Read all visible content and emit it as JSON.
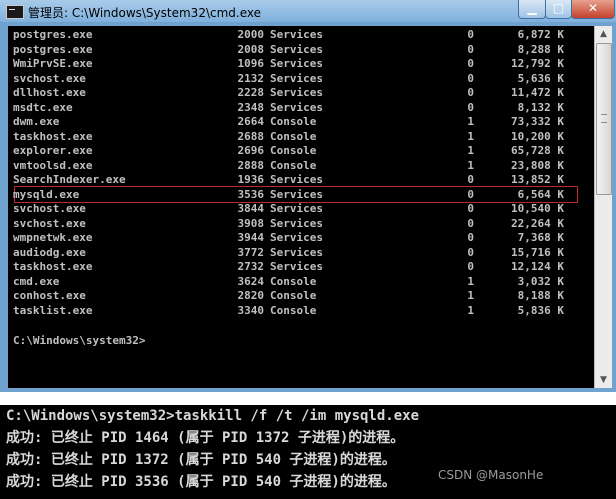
{
  "window": {
    "title": "管理员: C:\\Windows\\System32\\cmd.exe",
    "min_glyph": "▁",
    "max_glyph": "□",
    "close_glyph": "✕"
  },
  "tasklist": [
    {
      "name": "postgres.exe",
      "pid": "2000",
      "session": "Services",
      "num": "0",
      "mem": "6,872 K"
    },
    {
      "name": "postgres.exe",
      "pid": "2008",
      "session": "Services",
      "num": "0",
      "mem": "8,288 K"
    },
    {
      "name": "WmiPrvSE.exe",
      "pid": "1096",
      "session": "Services",
      "num": "0",
      "mem": "12,792 K"
    },
    {
      "name": "svchost.exe",
      "pid": "2132",
      "session": "Services",
      "num": "0",
      "mem": "5,636 K"
    },
    {
      "name": "dllhost.exe",
      "pid": "2228",
      "session": "Services",
      "num": "0",
      "mem": "11,472 K"
    },
    {
      "name": "msdtc.exe",
      "pid": "2348",
      "session": "Services",
      "num": "0",
      "mem": "8,132 K"
    },
    {
      "name": "dwm.exe",
      "pid": "2664",
      "session": "Console",
      "num": "1",
      "mem": "73,332 K"
    },
    {
      "name": "taskhost.exe",
      "pid": "2688",
      "session": "Console",
      "num": "1",
      "mem": "10,200 K"
    },
    {
      "name": "explorer.exe",
      "pid": "2696",
      "session": "Console",
      "num": "1",
      "mem": "65,728 K"
    },
    {
      "name": "vmtoolsd.exe",
      "pid": "2888",
      "session": "Console",
      "num": "1",
      "mem": "23,808 K"
    },
    {
      "name": "SearchIndexer.exe",
      "pid": "1936",
      "session": "Services",
      "num": "0",
      "mem": "13,852 K"
    },
    {
      "name": "mysqld.exe",
      "pid": "3536",
      "session": "Services",
      "num": "0",
      "mem": "6,564 K"
    },
    {
      "name": "svchost.exe",
      "pid": "3844",
      "session": "Services",
      "num": "0",
      "mem": "10,540 K"
    },
    {
      "name": "svchost.exe",
      "pid": "3908",
      "session": "Services",
      "num": "0",
      "mem": "22,264 K"
    },
    {
      "name": "wmpnetwk.exe",
      "pid": "3944",
      "session": "Services",
      "num": "0",
      "mem": "7,368 K"
    },
    {
      "name": "audiodg.exe",
      "pid": "3772",
      "session": "Services",
      "num": "0",
      "mem": "15,716 K"
    },
    {
      "name": "taskhost.exe",
      "pid": "2732",
      "session": "Services",
      "num": "0",
      "mem": "12,124 K"
    },
    {
      "name": "cmd.exe",
      "pid": "3624",
      "session": "Console",
      "num": "1",
      "mem": "3,032 K"
    },
    {
      "name": "conhost.exe",
      "pid": "2820",
      "session": "Console",
      "num": "1",
      "mem": "8,188 K"
    },
    {
      "name": "tasklist.exe",
      "pid": "3340",
      "session": "Console",
      "num": "1",
      "mem": "5,836 K"
    }
  ],
  "prompt": "C:\\Windows\\system32>",
  "lower_console": {
    "command": "C:\\Windows\\system32>taskkill /f /t /im mysqld.exe",
    "lines": [
      "成功: 已终止 PID 1464 (属于 PID 1372 子进程)的进程。",
      "成功: 已终止 PID 1372 (属于 PID 540 子进程)的进程。",
      "成功: 已终止 PID 3536 (属于 PID 540 子进程)的进程。"
    ]
  },
  "watermark": "CSDN @MasonHe"
}
